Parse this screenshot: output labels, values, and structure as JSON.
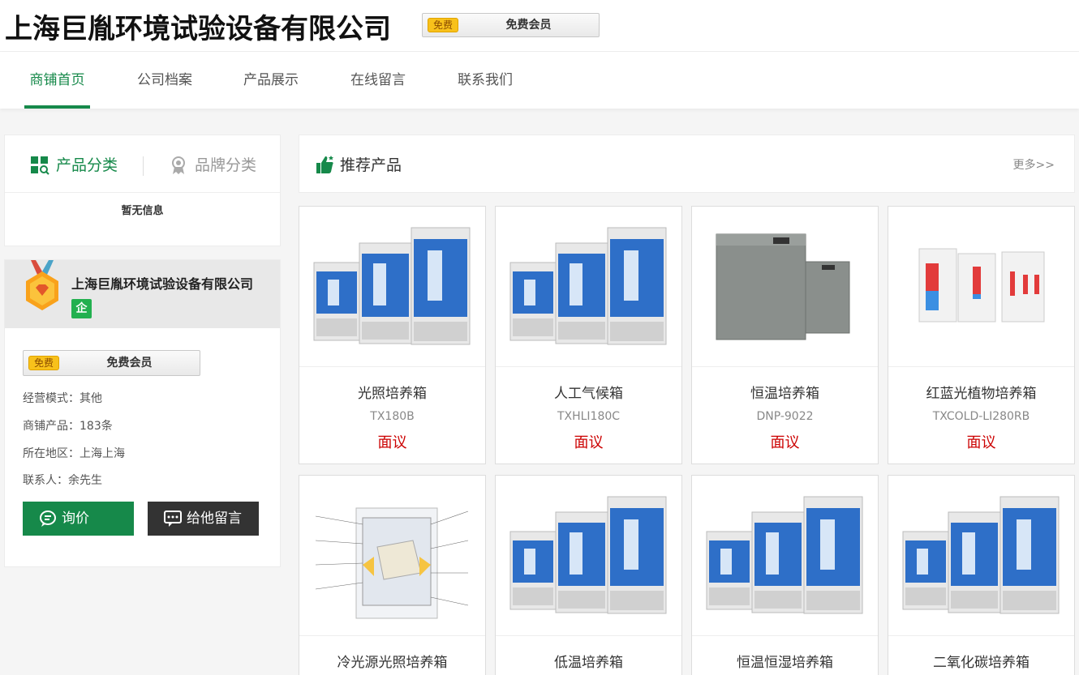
{
  "header": {
    "company_name": "上海巨胤环境试验设备有限公司",
    "member_tag": "免费",
    "member_label": "免费会员"
  },
  "nav": {
    "items": [
      {
        "label": "商铺首页",
        "active": true
      },
      {
        "label": "公司档案",
        "active": false
      },
      {
        "label": "产品展示",
        "active": false
      },
      {
        "label": "在线留言",
        "active": false
      },
      {
        "label": "联系我们",
        "active": false
      }
    ]
  },
  "category_panel": {
    "tab_product": "产品分类",
    "tab_brand": "品牌分类",
    "empty_text": "暂无信息"
  },
  "company_card": {
    "name": "上海巨胤环境试验设备有限公司",
    "ent_badge": "企",
    "member_tag": "免费",
    "member_label": "免费会员",
    "business_mode": "经营模式：其他",
    "products": "商铺产品：183条",
    "region": "所在地区：上海上海",
    "contact": "联系人：余先生",
    "inquiry_button": "询价",
    "message_button": "给他留言"
  },
  "recommended": {
    "title": "推荐产品",
    "more": "更多>>",
    "products": [
      {
        "name": "光照培养箱",
        "model": "TX180B",
        "price": "面议"
      },
      {
        "name": "人工气候箱",
        "model": "TXHLI180C",
        "price": "面议"
      },
      {
        "name": "恒温培养箱",
        "model": "DNP-9022",
        "price": "面议"
      },
      {
        "name": "红蓝光植物培养箱",
        "model": "TXCOLD-LI280RB",
        "price": "面议"
      },
      {
        "name": "冷光源光照培养箱",
        "model": "",
        "price": ""
      },
      {
        "name": "低温培养箱",
        "model": "",
        "price": ""
      },
      {
        "name": "恒温恒湿培养箱",
        "model": "",
        "price": ""
      },
      {
        "name": "二氧化碳培养箱",
        "model": "",
        "price": ""
      }
    ]
  },
  "colors": {
    "brand_green": "#16894a",
    "price_red": "#cc0000",
    "dark_button": "#333333",
    "free_tag": "#f8c11b"
  }
}
